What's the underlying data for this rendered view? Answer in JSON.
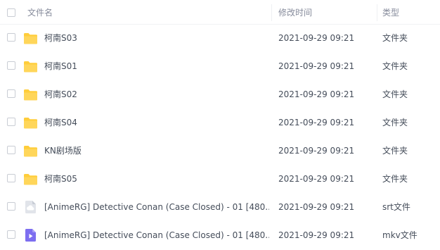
{
  "table": {
    "columns": {
      "name": "文件名",
      "modified": "修改时间",
      "type": "类型"
    },
    "rows": [
      {
        "name": "柯南S03",
        "modified": "2021-09-29 09:21",
        "type": "文件夹",
        "icon": "folder-icon"
      },
      {
        "name": "柯南S01",
        "modified": "2021-09-29 09:21",
        "type": "文件夹",
        "icon": "folder-icon"
      },
      {
        "name": "柯南S02",
        "modified": "2021-09-29 09:21",
        "type": "文件夹",
        "icon": "folder-icon"
      },
      {
        "name": "柯南S04",
        "modified": "2021-09-29 09:21",
        "type": "文件夹",
        "icon": "folder-icon"
      },
      {
        "name": "KN剧场版",
        "modified": "2021-09-29 09:21",
        "type": "文件夹",
        "icon": "folder-icon"
      },
      {
        "name": "柯南S05",
        "modified": "2021-09-29 09:21",
        "type": "文件夹",
        "icon": "folder-icon"
      },
      {
        "name": "[AnimeRG] Detective Conan (Case Closed) - 01 [480...",
        "modified": "2021-09-29 09:21",
        "type": "srt文件",
        "icon": "subtitle-file-icon"
      },
      {
        "name": "[AnimeRG] Detective Conan (Case Closed) - 01 [480...",
        "modified": "2021-09-29 09:21",
        "type": "mkv文件",
        "icon": "video-file-icon"
      }
    ]
  },
  "colors": {
    "folder": "#ffcd3b",
    "subtitle_file": "#dfe2e8",
    "video_file": "#7d6ef0",
    "header_text": "#878c9c",
    "row_text": "#454d5a"
  }
}
